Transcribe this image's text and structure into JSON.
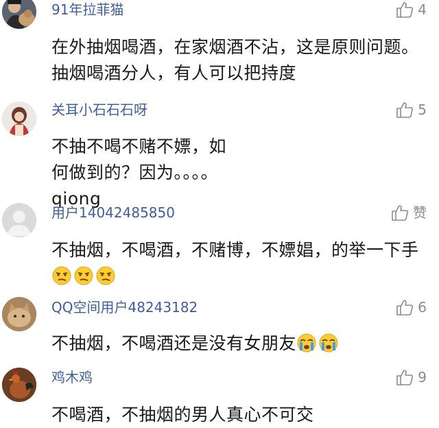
{
  "comments": [
    {
      "username": "91年拉菲猫",
      "likes": "4",
      "text": "在外抽烟喝酒，在家烟酒不沾，这是原则问题。抽烟喝酒分人，有人可以把持度",
      "avatar_icon": "person-with-dog-avatar"
    },
    {
      "username": "关耳小石石石呀",
      "likes": "5",
      "text": "不抽不喝不赌不嫖，如何做到的？因为。。。。qiong",
      "avatar_icon": "doll-figure-avatar"
    },
    {
      "username": "用户14042485850",
      "likes": "赞",
      "text": "不抽烟，不喝酒，不赌博，不嫖娼，的举一下手",
      "emojis": [
        "smug-face-emoji",
        "smug-face-emoji",
        "smug-face-emoji"
      ],
      "avatar_icon": "default-user-avatar"
    },
    {
      "username": "QQ空间用户48243182",
      "likes": "6",
      "text": "不抽烟，不喝酒还是没有女朋友",
      "emojis": [
        "crying-face-emoji",
        "crying-face-emoji"
      ],
      "avatar_icon": "cat-avatar"
    },
    {
      "username": "鸡木鸡",
      "likes": "9",
      "text": "不喝酒，不抽烟的男人真心不可交",
      "avatar_icon": "rooster-avatar"
    }
  ],
  "colors": {
    "username": "#3e5f9c",
    "text": "#1a1a1a",
    "like": "#8a8a8a"
  }
}
